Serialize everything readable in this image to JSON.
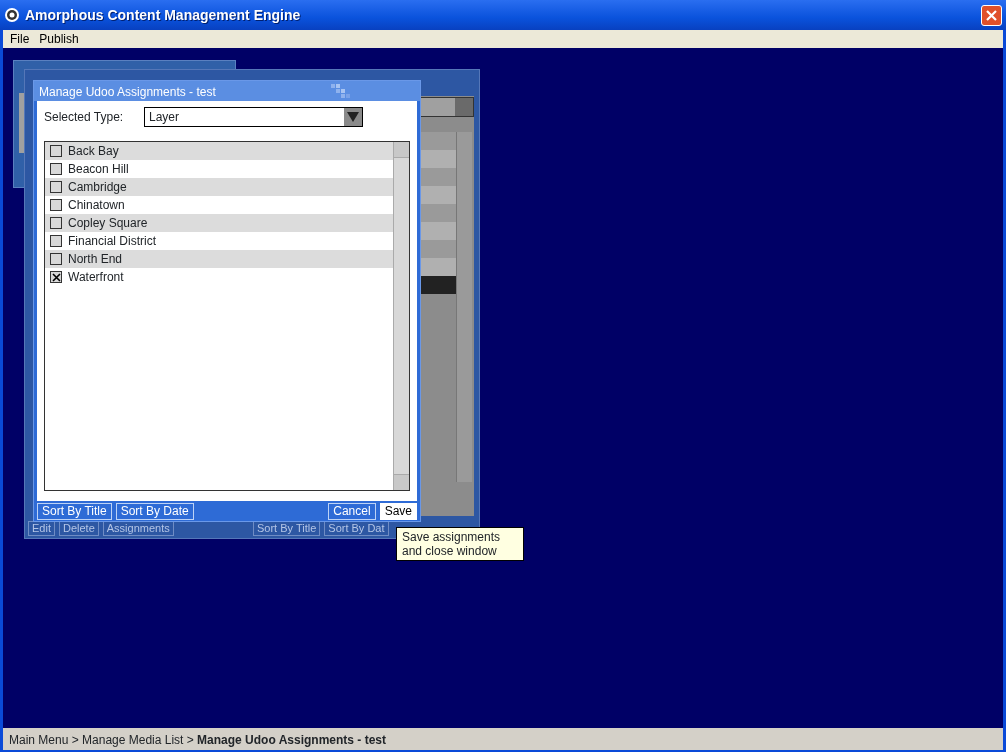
{
  "window": {
    "title": "Amorphous Content Management Engine"
  },
  "menu": [
    {
      "label": "File"
    },
    {
      "label": "Publish"
    }
  ],
  "background_window": {
    "buttons_left": [
      "Edit",
      "Delete",
      "Assignments"
    ],
    "buttons_right": [
      "Sort By Title",
      "Sort By Dat"
    ]
  },
  "dialog": {
    "title": "Manage Udoo Assignments - test",
    "type_label": "Selected Type:",
    "type_value": "Layer",
    "items": [
      {
        "label": "Back Bay",
        "checked": false
      },
      {
        "label": "Beacon Hill",
        "checked": false
      },
      {
        "label": "Cambridge",
        "checked": false
      },
      {
        "label": "Chinatown",
        "checked": false
      },
      {
        "label": "Copley Square",
        "checked": false
      },
      {
        "label": "Financial District",
        "checked": false
      },
      {
        "label": "North End",
        "checked": false
      },
      {
        "label": "Waterfront",
        "checked": true
      }
    ],
    "buttons_left": [
      "Sort By Title",
      "Sort By Date"
    ],
    "buttons_right": [
      {
        "label": "Cancel",
        "selected": false
      },
      {
        "label": "Save",
        "selected": true
      }
    ]
  },
  "tooltip": "Save assignments and close window",
  "status_bar": {
    "path": [
      "Main Menu",
      "Manage Media List"
    ],
    "separator": ">",
    "current": "Manage Udoo Assignments - test"
  }
}
